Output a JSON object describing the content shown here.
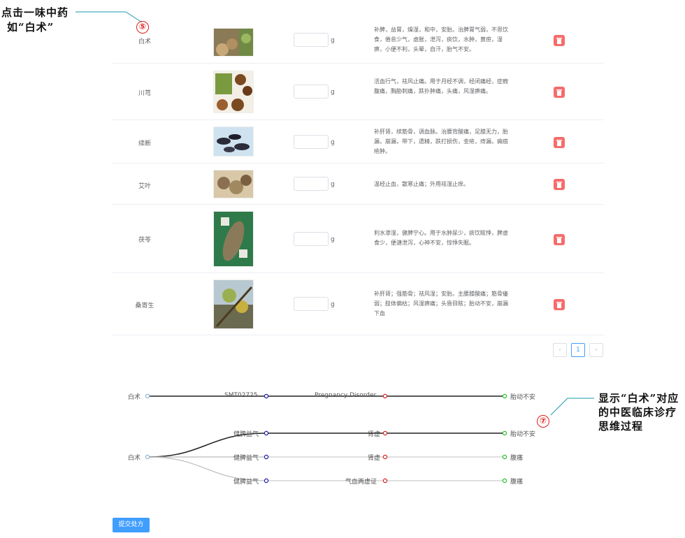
{
  "annotations": {
    "step5_num": "⑤",
    "step5_line1": "点击一味中药",
    "step5_line2": "如“白术”",
    "step7_num": "⑦",
    "step7_text": "显示“白术”对应的中医临床诊疗思维过程"
  },
  "table": {
    "unit": "g",
    "rows": [
      {
        "name": "白术",
        "desc": "补脾，益胃，燥湿，和中，安胎。治脾胃气弱，不思饮食，倦怠少气，虚胀，泄泻，痰饮，水肿，黄疸，湿痹，小便不利，头晕，自汗，胎气不安。"
      },
      {
        "name": "川芎",
        "desc": "活血行气，祛风止痛。用于月经不调，经闭痛经，症瘕腹痛，胸胁刺痛，跌扑肿痛，头痛，风湿痹痛。"
      },
      {
        "name": "续断",
        "desc": "补肝肾，续筋骨，调血脉。治腰背酸痛，足膝无力，胎漏，崩漏，带下，遗精，跌打损伤，金疮，痔漏，痈疽疮肿。"
      },
      {
        "name": "艾叶",
        "desc": "温经止血，散寒止痛；外用祛湿止痒。"
      },
      {
        "name": "茯苓",
        "desc": "利水渗湿，健脾宁心。用于水肿尿少，痰饮眩悸，脾虚食少，便溏泄泻，心神不安，惊悸失眠。"
      },
      {
        "name": "桑寄生",
        "desc": "补肝肾；强筋骨；祛风湿；安胎。主腰膝酸痛；筋骨痿弱；肢体偏枯；风湿痹痛；头昏目眩；胎动不安，崩漏下血"
      }
    ]
  },
  "pagination": {
    "prev": "‹",
    "current": "1",
    "next": "›"
  },
  "graph": {
    "top_path": [
      "白术",
      "SMT02725",
      "Pregnancy Disorder",
      "胎动不安"
    ],
    "root": "白术",
    "branches": [
      [
        "健脾益气",
        "肾虚",
        "胎动不安"
      ],
      [
        "健脾益气",
        "肾虚",
        "腹痛"
      ],
      [
        "健脾益气",
        "气血两虚证",
        "腹痛"
      ]
    ],
    "colors": {
      "root": "#8ab4d8",
      "level1": "#1a1aa0",
      "level2": "#d42020",
      "level3": "#22c022"
    }
  },
  "submit_label": "提交处方",
  "theme": {
    "primary": "#409eff",
    "danger": "#f56c6c"
  }
}
